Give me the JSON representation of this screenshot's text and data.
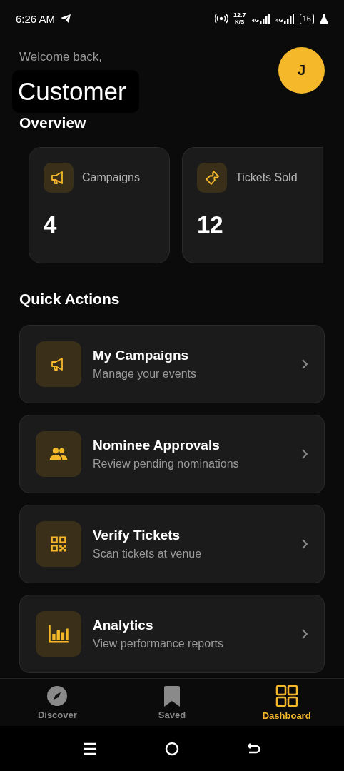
{
  "status_bar": {
    "time": "6:26 AM",
    "speed": "12.7",
    "speed_unit": "K/S",
    "network_1": "4G",
    "network_2": "4G",
    "battery": "16"
  },
  "header": {
    "greeting": "Welcome back,",
    "name": "Customer",
    "avatar": "J"
  },
  "overview": {
    "title": "Overview",
    "stats": [
      {
        "kind": "megaphone",
        "label": "Campaigns",
        "value": "4"
      },
      {
        "kind": "ticket",
        "label": "Tickets Sold",
        "value": "12"
      }
    ]
  },
  "quick_actions": {
    "title": "Quick Actions",
    "items": [
      {
        "kind": "megaphone",
        "title": "My Campaigns",
        "subtitle": "Manage your events"
      },
      {
        "kind": "people",
        "title": "Nominee Approvals",
        "subtitle": "Review pending nominations"
      },
      {
        "kind": "qr",
        "title": "Verify Tickets",
        "subtitle": "Scan tickets at venue"
      },
      {
        "kind": "chart",
        "title": "Analytics",
        "subtitle": "View performance reports"
      }
    ]
  },
  "bottom_nav": [
    {
      "kind": "compass",
      "label": "Discover",
      "selected": false
    },
    {
      "kind": "bookmark",
      "label": "Saved",
      "selected": false
    },
    {
      "kind": "grid",
      "label": "Dashboard",
      "selected": true
    }
  ]
}
